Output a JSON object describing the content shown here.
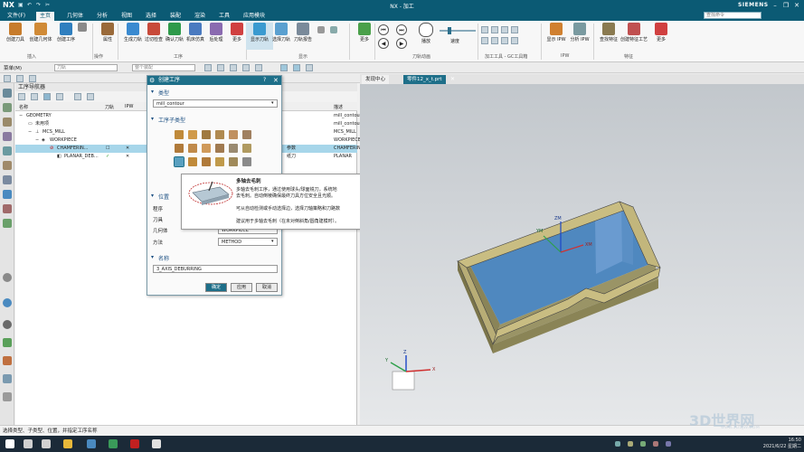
{
  "app": {
    "logo": "NX",
    "title": "NX - 加工",
    "brand": "SIEMENS",
    "search_placeholder": "查找命令"
  },
  "menubar": [
    "文件(F)",
    "主页",
    "几何体",
    "分析",
    "视图",
    "选择",
    "装配",
    "渲染",
    "工具",
    "应用模块"
  ],
  "ribbon": {
    "buttons": [
      {
        "label": "创建刀具",
        "color": "#c77c2c"
      },
      {
        "label": "创建几何体",
        "color": "#d08a36"
      },
      {
        "label": "创建工序",
        "color": "#2f7fbf"
      },
      {
        "label": "",
        "color": "#8a8a8a"
      },
      {
        "label": "属性",
        "color": "#9a6a3a"
      },
      {
        "label": "生成刀轨",
        "color": "#3a8ad0"
      },
      {
        "label": "过切检查",
        "color": "#c84a3a"
      },
      {
        "label": "确认刀轨",
        "color": "#2e9a4a"
      },
      {
        "label": "机床仿真",
        "color": "#4a7ac0"
      },
      {
        "label": "后处理",
        "color": "#8a6ab0"
      },
      {
        "label": "更多",
        "color": "#d04040"
      },
      {
        "label": "显示刀轨",
        "color": "#3a9ad0"
      },
      {
        "label": "选择刀轨",
        "color": "#5aa0d0"
      },
      {
        "label": "刀轨报告",
        "color": "#7a8a9a"
      },
      {
        "label": "更多",
        "color": "#4aa04a"
      },
      {
        "label": "播放",
        "color": "#606060"
      },
      {
        "label": "更多",
        "color": "#d09030"
      },
      {
        "label": "显示 IPW",
        "color": "#d08030"
      },
      {
        "label": "分析 IPW",
        "color": "#7a9aa0"
      },
      {
        "label": "查找特征",
        "color": "#8a7a50"
      },
      {
        "label": "创建特征工艺",
        "color": "#c05050"
      },
      {
        "label": "更多",
        "color": "#d04040"
      }
    ],
    "groups": [
      "插入",
      "操作",
      "工序",
      "显示",
      "刀轨动画",
      "加工工具 - GC工具箱",
      "IPW",
      "特征"
    ],
    "speed_label": "速度"
  },
  "toolbar": {
    "menu_label": "菜单(M)",
    "filter1": "刀轨",
    "filter2": "整个装配"
  },
  "navigator": {
    "title": "工序导航器",
    "columns": [
      "名称",
      "刀轨",
      "IPW",
      "描述"
    ],
    "rows": [
      {
        "name": "GEOMETRY",
        "path": "",
        "ipw": "",
        "desc": "mill_contour"
      },
      {
        "name": "未用项",
        "path": "",
        "ipw": "",
        "desc": "mill_contour"
      },
      {
        "name": "MCS_MILL",
        "path": "",
        "ipw": "",
        "desc": "MCS_MILL"
      },
      {
        "name": "WORKPIECE",
        "path": "",
        "ipw": "",
        "desc": "WORKPIECE"
      },
      {
        "name": "CHAMFERIN...",
        "path": "☐",
        "ipw": "✕",
        "desc": "CHAMFERIN",
        "extra": "参数"
      },
      {
        "name": "PLANAR_DEB...",
        "path": "✓",
        "ipw": "✕",
        "desc": "PLANAR",
        "extra": "纸刀"
      }
    ]
  },
  "dialog": {
    "title": "创建工序",
    "type_section": "类型",
    "type_value": "mill_contour",
    "subtype_section": "工序子类型",
    "position_section": "位置",
    "fields": [
      {
        "label": "程序",
        "value": ""
      },
      {
        "label": "刀具",
        "value": ""
      },
      {
        "label": "几何体",
        "value": "WORKPIECE"
      },
      {
        "label": "方法",
        "value": "METHOD"
      }
    ],
    "name_section": "名称",
    "name_value": "3_AXIS_DEBURRING",
    "ok": "确定",
    "apply": "应用",
    "cancel": "取消"
  },
  "tooltip": {
    "title": "多轴去毛刺",
    "line1": "多轴去毛刺工序，通过使用球头/球面铣刀，系统地",
    "line2": "去毛刺。自动倒棱确保最终刀具方位安全且光顺。",
    "line3": "可从自动检测或手动选择边，选择刀轴策略和刀路数",
    "line4": "建议用于多轴去毛刺（在未对倒斜角/圆角建模时）。"
  },
  "tabs": [
    "发现中心",
    "零件12_x_t.prt"
  ],
  "axis": {
    "zm": "ZM",
    "ym": "YM",
    "xm": "XM",
    "z": "Z",
    "y": "Y",
    "x": "X"
  },
  "status": "选择类型、子类型、位置，并指定工序名称",
  "clock": {
    "time": "16:50",
    "date": "2021/6/22 星期二"
  },
  "watermark": {
    "text": "3D世界网",
    "url": "www.3DSJW.COM"
  }
}
